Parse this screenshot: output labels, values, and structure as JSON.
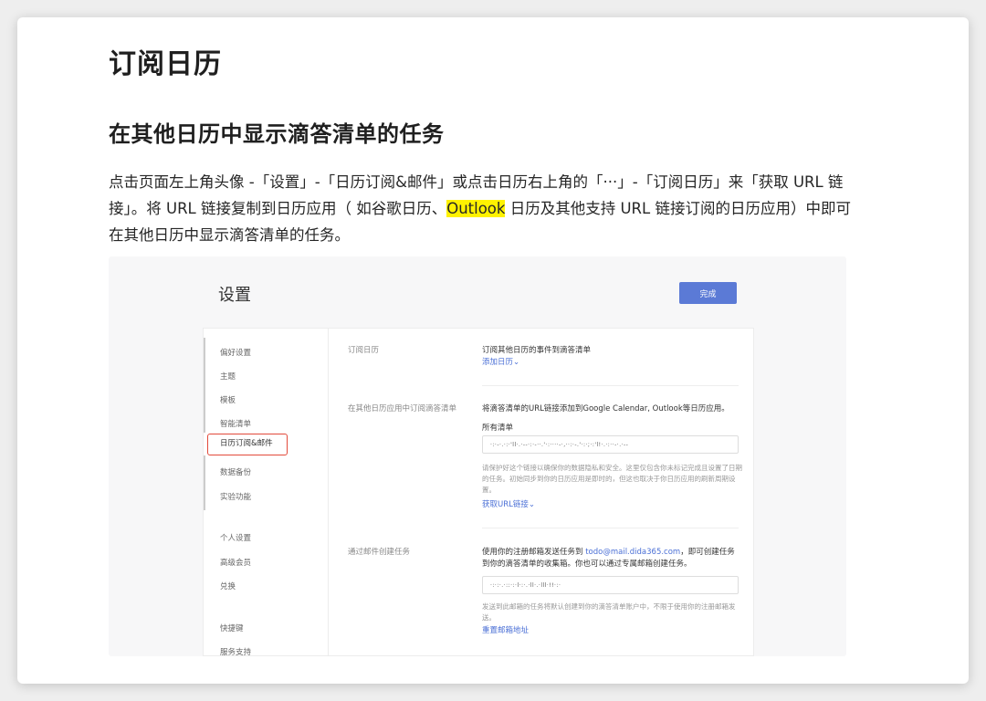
{
  "article": {
    "title": "订阅日历",
    "section_title": "在其他日历中显示滴答清单的任务",
    "paragraph_before": "点击页面左上角头像 -「设置」-「日历订阅&邮件」或点击日历右上角的「···」-「订阅日历」来「获取 URL 链接」。将 URL 链接复制到日历应用（ 如谷歌日历、",
    "paragraph_highlight": "Outlook",
    "paragraph_after": " 日历及其他支持 URL 链接订阅的日历应用）中即可在其他日历中显示滴答清单的任务。"
  },
  "screenshot": {
    "page_title": "设置",
    "done_button": "完成",
    "sidebar": {
      "items": [
        "偏好设置",
        "主题",
        "模板",
        "智能清单",
        "日历订阅&邮件",
        "数据备份",
        "实验功能",
        "个人设置",
        "高级会员",
        "兑换",
        "快捷键",
        "服务支持"
      ],
      "active_index": 4
    },
    "sections": [
      {
        "label": "订阅日历",
        "text": "订阅其他日历的事件到滴答清单",
        "link": "添加日历⌄"
      },
      {
        "label": "在其他日历应用中订阅滴答清单",
        "text": "将滴答清单的URL链接添加到Google Calendar, Outlook等日历应用。",
        "field_label": "所有清单",
        "field_value": "·:·-·.·:·'ll·.·--·:·-··.'·:····-·,··:·-.'·:·;·:'l!·.·:··-·.·--",
        "hint": "请保护好这个链接以确保你的数据隐私和安全。这里仅包含你未标记完成且设置了日期的任务。初始同步到你的日历应用是即时的，但这也取决于你日历应用的刷新周期设置。",
        "link": "获取URL链接⌄"
      },
      {
        "label": "通过邮件创建任务",
        "text_before": "使用你的注册邮箱发送任务到 ",
        "email": "todo@mail.dida365.com",
        "text_after": "，即可创建任务到你的滴答清单的收集箱。你也可以通过专属邮箱创建任务。",
        "field_value": "·:·:·.·::·:·l·:·.·ll·.·lll·!!·:·",
        "hint": "发送到此邮箱的任务将默认创建到你的滴答清单账户中，不限于使用你的注册邮箱发送。",
        "link": "重置邮箱地址"
      }
    ]
  },
  "colors": {
    "highlight": "#fff200",
    "accent_button": "#5b7ad6",
    "link": "#4a6fd6",
    "active_border": "#e24a3b"
  }
}
